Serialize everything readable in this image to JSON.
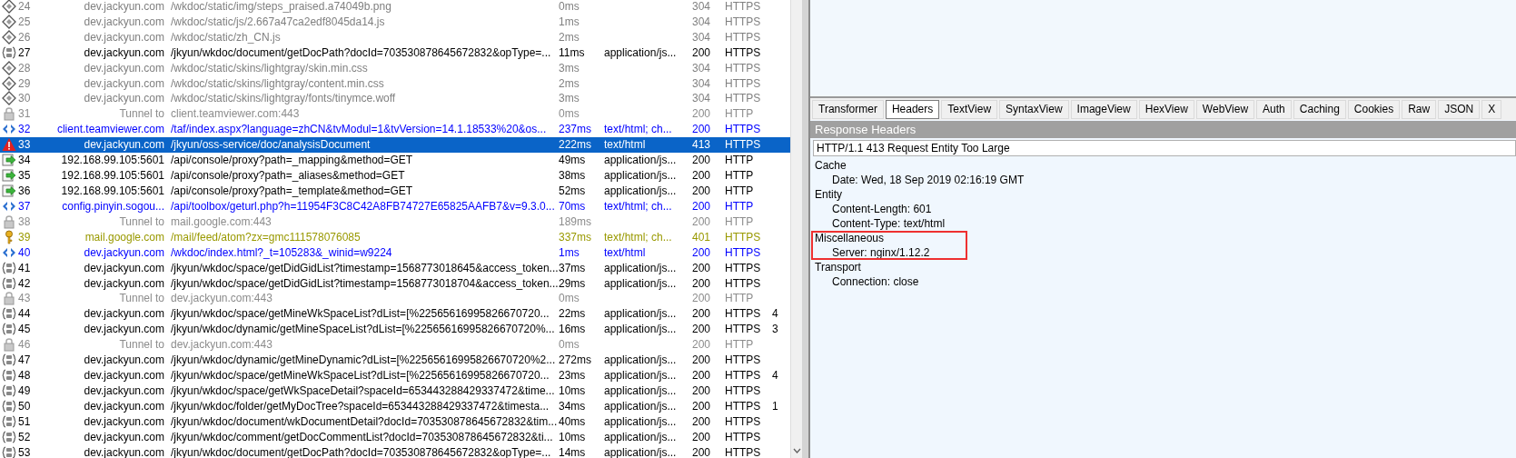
{
  "sessions": [
    {
      "number": "24",
      "kind": "static",
      "host": "dev.jackyun.com",
      "url": "/wkdoc/static/img/steps_praised.a74049b.png",
      "time": "0ms",
      "status": "304",
      "protocol": "HTTPS",
      "selected": false
    },
    {
      "number": "25",
      "kind": "static",
      "host": "dev.jackyun.com",
      "url": "/wkdoc/static/js/2.667a47ca2edf8045da14.js",
      "time": "1ms",
      "status": "304",
      "protocol": "HTTPS",
      "selected": false
    },
    {
      "number": "26",
      "kind": "static",
      "host": "dev.jackyun.com",
      "url": "/wkdoc/static/zh_CN.js",
      "time": "2ms",
      "status": "304",
      "protocol": "HTTPS",
      "selected": false
    },
    {
      "number": "27",
      "kind": "json",
      "host": "dev.jackyun.com",
      "url": "/jkyun/wkdoc/document/getDocPath?docId=703530878645672832&opType=...",
      "time": "11ms",
      "content_type": "application/js...",
      "status": "200",
      "protocol": "HTTPS",
      "selected": false
    },
    {
      "number": "28",
      "kind": "static",
      "host": "dev.jackyun.com",
      "url": "/wkdoc/static/skins/lightgray/skin.min.css",
      "time": "3ms",
      "status": "304",
      "protocol": "HTTPS",
      "selected": false
    },
    {
      "number": "29",
      "kind": "static",
      "host": "dev.jackyun.com",
      "url": "/wkdoc/static/skins/lightgray/content.min.css",
      "time": "2ms",
      "status": "304",
      "protocol": "HTTPS",
      "selected": false
    },
    {
      "number": "30",
      "kind": "static",
      "host": "dev.jackyun.com",
      "url": "/wkdoc/static/skins/lightgray/fonts/tinymce.woff",
      "time": "3ms",
      "status": "304",
      "protocol": "HTTPS",
      "selected": false
    },
    {
      "number": "31",
      "kind": "tunnel",
      "host": "Tunnel to",
      "url": "client.teamviewer.com:443",
      "time": "0ms",
      "status": "200",
      "protocol": "HTTP",
      "selected": false
    },
    {
      "number": "32",
      "kind": "html",
      "host": "client.teamviewer.com",
      "url": "/taf/index.aspx?language=zhCN&tvModul=1&tvVersion=14.1.18533%20&os...",
      "time": "237ms",
      "content_type": "text/html; ch...",
      "status": "200",
      "protocol": "HTTPS",
      "selected": false
    },
    {
      "number": "33",
      "kind": "error",
      "host": "dev.jackyun.com",
      "url": "/jkyun/oss-service/doc/analysisDocument",
      "time": "222ms",
      "content_type": "text/html",
      "status": "413",
      "protocol": "HTTPS",
      "selected": true
    },
    {
      "number": "34",
      "kind": "request",
      "host": "192.168.99.105:5601",
      "url": "/api/console/proxy?path=_mapping&method=GET",
      "time": "49ms",
      "content_type": "application/js...",
      "status": "200",
      "protocol": "HTTP",
      "selected": false
    },
    {
      "number": "35",
      "kind": "request",
      "host": "192.168.99.105:5601",
      "url": "/api/console/proxy?path=_aliases&method=GET",
      "time": "38ms",
      "content_type": "application/js...",
      "status": "200",
      "protocol": "HTTP",
      "selected": false
    },
    {
      "number": "36",
      "kind": "request",
      "host": "192.168.99.105:5601",
      "url": "/api/console/proxy?path=_template&method=GET",
      "time": "52ms",
      "content_type": "application/js...",
      "status": "200",
      "protocol": "HTTP",
      "selected": false
    },
    {
      "number": "37",
      "kind": "html",
      "host": "config.pinyin.sogou...",
      "url": "/api/toolbox/geturl.php?h=11954F3C8C42A8FB74727E65825AAFB7&v=9.3.0...",
      "time": "70ms",
      "content_type": "text/html; ch...",
      "status": "200",
      "protocol": "HTTP",
      "selected": false
    },
    {
      "number": "38",
      "kind": "tunnel",
      "host": "Tunnel to",
      "url": "mail.google.com:443",
      "time": "189ms",
      "status": "200",
      "protocol": "HTTP",
      "selected": false
    },
    {
      "number": "39",
      "kind": "auth",
      "host": "mail.google.com",
      "url": "/mail/feed/atom?zx=gmc111578076085",
      "time": "337ms",
      "content_type": "text/html; ch...",
      "status": "401",
      "protocol": "HTTPS",
      "selected": false
    },
    {
      "number": "40",
      "kind": "html",
      "host": "dev.jackyun.com",
      "url": "/wkdoc/index.html?_t=105283&_winid=w9224",
      "time": "1ms",
      "content_type": "text/html",
      "status": "200",
      "protocol": "HTTPS",
      "selected": false
    },
    {
      "number": "41",
      "kind": "json",
      "host": "dev.jackyun.com",
      "url": "/jkyun/wkdoc/space/getDidGidList?timestamp=1568773018645&access_token...",
      "time": "37ms",
      "content_type": "application/js...",
      "status": "200",
      "protocol": "HTTPS",
      "selected": false
    },
    {
      "number": "42",
      "kind": "json",
      "host": "dev.jackyun.com",
      "url": "/jkyun/wkdoc/space/getDidGidList?timestamp=1568773018704&access_token...",
      "time": "29ms",
      "content_type": "application/js...",
      "status": "200",
      "protocol": "HTTPS",
      "selected": false
    },
    {
      "number": "43",
      "kind": "tunnel",
      "host": "Tunnel to",
      "url": "dev.jackyun.com:443",
      "time": "0ms",
      "status": "200",
      "protocol": "HTTP",
      "selected": false
    },
    {
      "number": "44",
      "kind": "json",
      "host": "dev.jackyun.com",
      "url": "/jkyun/wkdoc/space/getMineWkSpaceList?dList=[%22565616995826670720...",
      "time": "22ms",
      "content_type": "application/js...",
      "status": "200",
      "protocol": "HTTPS",
      "column_8": "4",
      "selected": false
    },
    {
      "number": "45",
      "kind": "json",
      "host": "dev.jackyun.com",
      "url": "/jkyun/wkdoc/dynamic/getMineSpaceList?dList=[%22565616995826670720%...",
      "time": "16ms",
      "content_type": "application/js...",
      "status": "200",
      "protocol": "HTTPS",
      "column_8": "3",
      "selected": false
    },
    {
      "number": "46",
      "kind": "tunnel",
      "host": "Tunnel to",
      "url": "dev.jackyun.com:443",
      "time": "0ms",
      "status": "200",
      "protocol": "HTTP",
      "selected": false
    },
    {
      "number": "47",
      "kind": "json",
      "host": "dev.jackyun.com",
      "url": "/jkyun/wkdoc/dynamic/getMineDynamic?dList=[%22565616995826670720%2...",
      "time": "272ms",
      "content_type": "application/js...",
      "status": "200",
      "protocol": "HTTPS",
      "selected": false
    },
    {
      "number": "48",
      "kind": "json",
      "host": "dev.jackyun.com",
      "url": "/jkyun/wkdoc/space/getMineWkSpaceList?dList=[%22565616995826670720...",
      "time": "23ms",
      "content_type": "application/js...",
      "status": "200",
      "protocol": "HTTPS",
      "column_8": "4",
      "selected": false
    },
    {
      "number": "49",
      "kind": "json",
      "host": "dev.jackyun.com",
      "url": "/jkyun/wkdoc/space/getWkSpaceDetail?spaceId=653443288429337472&time...",
      "time": "10ms",
      "content_type": "application/js...",
      "status": "200",
      "protocol": "HTTPS",
      "selected": false
    },
    {
      "number": "50",
      "kind": "json",
      "host": "dev.jackyun.com",
      "url": "/jkyun/wkdoc/folder/getMyDocTree?spaceId=653443288429337472&timesta...",
      "time": "34ms",
      "content_type": "application/js...",
      "status": "200",
      "protocol": "HTTPS",
      "column_8": "1",
      "selected": false
    },
    {
      "number": "51",
      "kind": "json",
      "host": "dev.jackyun.com",
      "url": "/jkyun/wkdoc/document/wkDocumentDetail?docId=703530878645672832&tim...",
      "time": "40ms",
      "content_type": "application/js...",
      "status": "200",
      "protocol": "HTTPS",
      "selected": false
    },
    {
      "number": "52",
      "kind": "json",
      "host": "dev.jackyun.com",
      "url": "/jkyun/wkdoc/comment/getDocCommentList?docId=703530878645672832&ti...",
      "time": "10ms",
      "content_type": "application/js...",
      "status": "200",
      "protocol": "HTTPS",
      "selected": false
    },
    {
      "number": "53",
      "kind": "json",
      "host": "dev.jackyun.com",
      "url": "/jkyun/wkdoc/document/getDocPath?docId=703530878645672832&opType=...",
      "time": "14ms",
      "content_type": "application/js...",
      "status": "200",
      "protocol": "HTTPS",
      "selected": false
    }
  ],
  "inspector": {
    "tabs": [
      {
        "label": "Transformer",
        "selected": false
      },
      {
        "label": "Headers",
        "selected": true
      },
      {
        "label": "TextView",
        "selected": false
      },
      {
        "label": "SyntaxView",
        "selected": false
      },
      {
        "label": "ImageView",
        "selected": false
      },
      {
        "label": "HexView",
        "selected": false
      },
      {
        "label": "WebView",
        "selected": false
      },
      {
        "label": "Auth",
        "selected": false
      },
      {
        "label": "Caching",
        "selected": false
      },
      {
        "label": "Cookies",
        "selected": false
      },
      {
        "label": "Raw",
        "selected": false
      },
      {
        "label": "JSON",
        "selected": false
      },
      {
        "label": "X",
        "selected": false
      }
    ],
    "section_title": "Response Headers",
    "status_line": "HTTP/1.1 413 Request Entity Too Large",
    "groups": [
      {
        "name": "Cache",
        "highlighted": false,
        "children": [
          {
            "text": "Date: Wed, 18 Sep 2019 02:16:19 GMT"
          }
        ]
      },
      {
        "name": "Entity",
        "highlighted": false,
        "children": [
          {
            "text": "Content-Length: 601"
          },
          {
            "text": "Content-Type: text/html"
          }
        ]
      },
      {
        "name": "Miscellaneous",
        "highlighted": true,
        "children": [
          {
            "text": "Server: nginx/1.12.2"
          }
        ]
      },
      {
        "name": "Transport",
        "highlighted": false,
        "children": [
          {
            "text": "Connection: close"
          }
        ]
      }
    ]
  }
}
